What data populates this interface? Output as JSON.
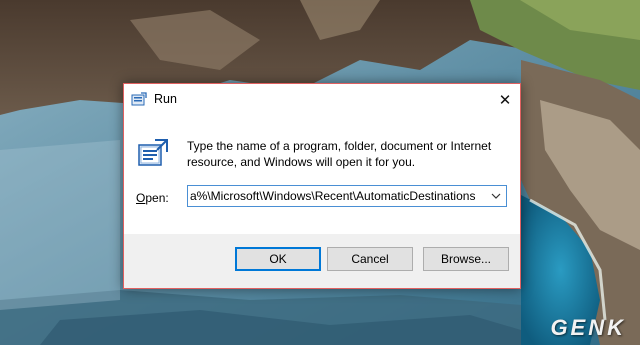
{
  "dialog": {
    "title": "Run",
    "description": "Type the name of a program, folder, document or Internet resource, and Windows will open it for you.",
    "open_label_prefix": "",
    "open_label_underlined": "O",
    "open_label_rest": "pen:",
    "open_value": "a%\\Microsoft\\Windows\\Recent\\AutomaticDestinations",
    "close_glyph": "✕",
    "icons": {
      "title": "run-icon",
      "app": "run-icon",
      "close": "close-icon",
      "dropdown": "chevron-down-icon"
    },
    "colors": {
      "accent": "#0078d7",
      "border": "#e06060",
      "footer": "#f0f0f0"
    }
  },
  "buttons": {
    "ok": "OK",
    "cancel": "Cancel",
    "browse": "Browse..."
  },
  "watermark": "GENK"
}
